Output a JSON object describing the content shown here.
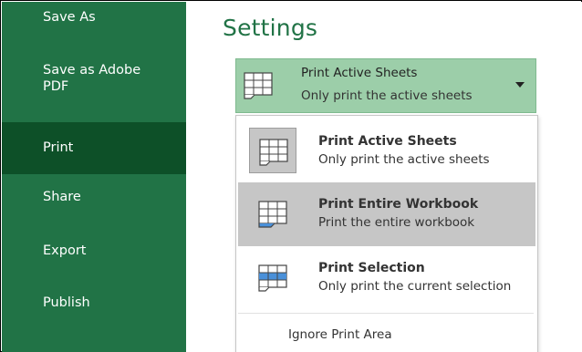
{
  "sidebar": {
    "items": [
      {
        "id": "save-as",
        "label": "Save As"
      },
      {
        "id": "save-adobe",
        "label": "Save as Adobe\nPDF"
      },
      {
        "id": "print",
        "label": "Print"
      },
      {
        "id": "share",
        "label": "Share"
      },
      {
        "id": "export",
        "label": "Export"
      },
      {
        "id": "publish",
        "label": "Publish"
      }
    ],
    "active": "Print"
  },
  "main": {
    "title": "Settings",
    "combo": {
      "title": "Print Active Sheets",
      "desc": "Only print the active sheets",
      "icon": "sheet-grid-icon",
      "arrow_icon": "caret-down-icon"
    },
    "menu": {
      "items": [
        {
          "title": "Print Active Sheets",
          "desc": "Only print the active sheets",
          "icon": "active-sheets-icon",
          "state": "selected"
        },
        {
          "title": "Print Entire Workbook",
          "desc": "Print the entire workbook",
          "icon": "entire-workbook-icon",
          "state": "hover"
        },
        {
          "title": "Print Selection",
          "desc": "Only print the current selection",
          "icon": "selection-icon",
          "state": "normal"
        }
      ],
      "ignore_label": "Ignore Print Area"
    }
  },
  "colors": {
    "sidebar_bg": "#217346",
    "sidebar_active": "#0d5028",
    "accent": "#217346",
    "combo_bg": "#9ccea9",
    "hover_bg": "#c6c6c6",
    "icon_blue": "#4a90d9"
  }
}
